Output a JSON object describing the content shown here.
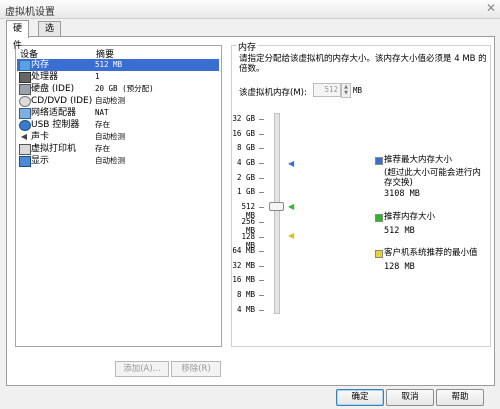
{
  "window": {
    "title": "虚拟机设置"
  },
  "tabs": [
    {
      "label": "硬件"
    },
    {
      "label": "选项"
    }
  ],
  "device_list": {
    "headers": {
      "device": "设备",
      "summary": "摘要"
    },
    "rows": [
      {
        "icon": "memory-icon",
        "name": "内存",
        "summary": "512 MB"
      },
      {
        "icon": "cpu-icon",
        "name": "处理器",
        "summary": "1"
      },
      {
        "icon": "hard-disk-icon",
        "name": "硬盘 (IDE)",
        "summary": "20 GB (预分配)"
      },
      {
        "icon": "cd-dvd-icon",
        "name": "CD/DVD (IDE)",
        "summary": "自动检测"
      },
      {
        "icon": "network-icon",
        "name": "网络适配器",
        "summary": "NAT"
      },
      {
        "icon": "usb-icon",
        "name": "USB 控制器",
        "summary": "存在"
      },
      {
        "icon": "sound-icon",
        "name": "声卡",
        "summary": "自动检测"
      },
      {
        "icon": "printer-icon",
        "name": "虚拟打印机",
        "summary": "存在"
      },
      {
        "icon": "display-icon",
        "name": "显示",
        "summary": "自动检测"
      }
    ],
    "add_button": "添加(A)...",
    "remove_button": "移除(R)"
  },
  "memory": {
    "section_title": "内存",
    "description": "请指定分配给该虚拟机的内存大小。该内存大小值必须是 4 MB 的倍数。",
    "field_label": "该虚拟机内存(M):",
    "value": "512",
    "unit": "MB",
    "scale_labels": [
      "32 GB",
      "16 GB",
      "8 GB",
      "4 GB",
      "2 GB",
      "1 GB",
      "512 MB",
      "256 MB",
      "128 MB",
      "64 MB",
      "32 MB",
      "16 MB",
      "8 MB",
      "4 MB"
    ],
    "legend": {
      "max": {
        "title": "推荐最大内存大小",
        "note": "(超过此大小可能会进行内存交换)",
        "value": "3108 MB",
        "color": "#3a6fd0"
      },
      "recommended": {
        "title": "推荐内存大小",
        "value": "512 MB",
        "color": "#2fb82f"
      },
      "minimum": {
        "title": "客户机系统推荐的最小值",
        "value": "128 MB",
        "color": "#e6d23c"
      }
    }
  },
  "buttons": {
    "ok": "确定",
    "cancel": "取消",
    "help": "帮助"
  }
}
